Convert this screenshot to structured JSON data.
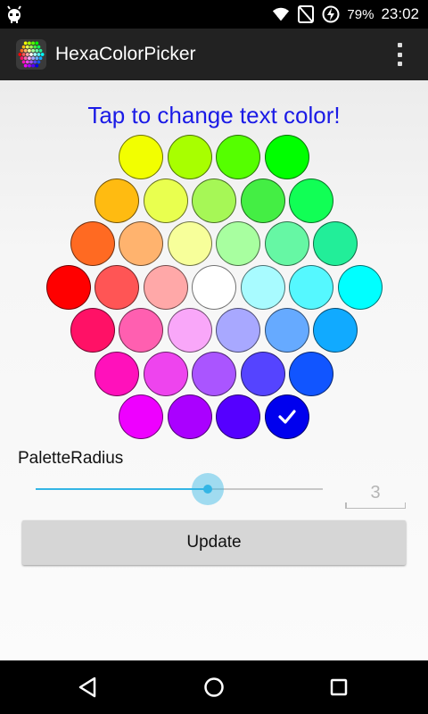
{
  "status_bar": {
    "battery_percent": "79%",
    "time": "23:02",
    "icons": [
      "debug-bug-icon",
      "wifi-icon",
      "no-signal-icon",
      "battery-charging-icon"
    ]
  },
  "app_bar": {
    "title": "HexaColorPicker",
    "icons": [
      "app-hex-palette-icon",
      "overflow-menu-icon"
    ]
  },
  "main": {
    "headline": "Tap to change text color!",
    "headline_color": "#1a1ae6",
    "palette": {
      "rows": [
        [
          "#f2ff00",
          "#a8ff00",
          "#55ff00",
          "#00ff00"
        ],
        [
          "#ffbb11",
          "#e9ff4f",
          "#a6f756",
          "#44ee44",
          "#11ff55"
        ],
        [
          "#ff6a22",
          "#ffb36e",
          "#f7ff9a",
          "#a8ffa0",
          "#66f7a4",
          "#22ee99"
        ],
        [
          "#ff0000",
          "#ff5555",
          "#ffa8a8",
          "#ffffff",
          "#a8fbff",
          "#55f8ff",
          "#00ffff"
        ],
        [
          "#ff1166",
          "#ff5fb0",
          "#f9a7f9",
          "#a8a8ff",
          "#66aaff",
          "#11aaff"
        ],
        [
          "#ff11bb",
          "#ee44ee",
          "#aa55ff",
          "#5544ff",
          "#1155ff"
        ],
        [
          "#ee00ff",
          "#aa00ff",
          "#5500ff",
          "#0000ee"
        ]
      ],
      "selected": "#0000ee"
    },
    "palette_radius": {
      "label": "PaletteRadius",
      "value": "3",
      "fraction": 0.6
    },
    "update_button_label": "Update",
    "accent_color": "#33b5e5"
  },
  "nav_bar": {
    "icons": [
      "back-icon",
      "home-icon",
      "recents-icon"
    ]
  }
}
